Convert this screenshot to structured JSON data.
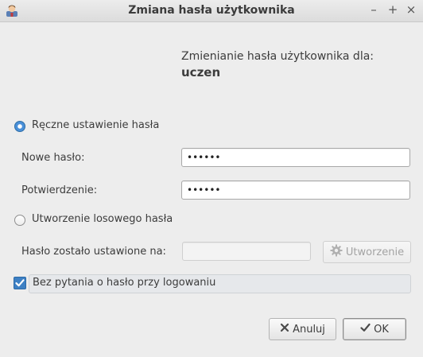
{
  "window": {
    "title": "Zmiana hasła użytkownika",
    "minimize_glyph": "–",
    "maximize_glyph": "+",
    "close_glyph": "×"
  },
  "heading": {
    "line": "Zmienianie hasła użytkownika dla:",
    "username": "uczen"
  },
  "manual": {
    "radio_label": "Ręczne ustawienie hasła",
    "selected": true,
    "new_password_label": "Nowe hasło:",
    "new_password_value": "••••••",
    "confirm_label": "Potwierdzenie:",
    "confirm_value": "••••••"
  },
  "random": {
    "radio_label": "Utworzenie losowego hasła",
    "selected": false,
    "set_to_label": "Hasło zostało ustawione na:",
    "set_to_value": "",
    "generate_label": "Utworzenie"
  },
  "no_ask": {
    "label": "Bez pytania o hasło przy logowaniu",
    "checked": true
  },
  "buttons": {
    "cancel_label": "Anuluj",
    "ok_label": "OK"
  },
  "colors": {
    "accent": "#4a90d9",
    "background": "#ededed"
  }
}
